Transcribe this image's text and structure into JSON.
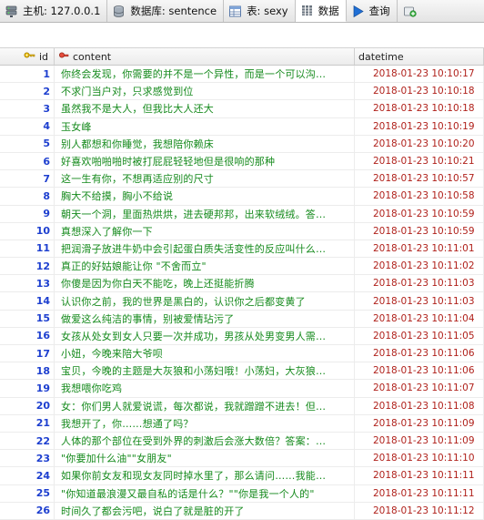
{
  "tabs": [
    {
      "icon": "server-icon",
      "label": "主机: 127.0.0.1"
    },
    {
      "icon": "database-icon",
      "label": "数据库: sentence"
    },
    {
      "icon": "table-icon",
      "label": "表: sexy"
    },
    {
      "icon": "data-grid-icon",
      "label": "数据"
    },
    {
      "icon": "play-icon",
      "label": "查询"
    },
    {
      "icon": "new-query-tab-icon",
      "label": ""
    }
  ],
  "active_tab": "数据",
  "columns": [
    {
      "icon": "key-icon",
      "label": "id"
    },
    {
      "icon": "field-icon",
      "label": "content"
    },
    {
      "icon": "",
      "label": "datetime"
    }
  ],
  "rows": [
    {
      "id": "1",
      "content": "你终会发现，你需要的并不是一个异性，而是一个可以沟…",
      "datetime": "2018-01-23 10:10:17"
    },
    {
      "id": "2",
      "content": "不求门当户对，只求感觉到位",
      "datetime": "2018-01-23 10:10:18"
    },
    {
      "id": "3",
      "content": "虽然我不是大人，但我比大人还大",
      "datetime": "2018-01-23 10:10:18"
    },
    {
      "id": "4",
      "content": "玉女峰",
      "datetime": "2018-01-23 10:10:19"
    },
    {
      "id": "5",
      "content": "别人都想和你睡觉，我想陪你赖床",
      "datetime": "2018-01-23 10:10:20"
    },
    {
      "id": "6",
      "content": "好喜欢啪啪啪时被打屁屁轻轻地但是很响的那种",
      "datetime": "2018-01-23 10:10:21"
    },
    {
      "id": "7",
      "content": "这一生有你，不想再适应别的尺寸",
      "datetime": "2018-01-23 10:10:57"
    },
    {
      "id": "8",
      "content": "胸大不给摸，胸小不给说",
      "datetime": "2018-01-23 10:10:58"
    },
    {
      "id": "9",
      "content": "朝天一个洞，里面热烘烘，进去硬邦邦，出来软绒绒。答…",
      "datetime": "2018-01-23 10:10:59"
    },
    {
      "id": "10",
      "content": "真想深入了解你一下",
      "datetime": "2018-01-23 10:10:59"
    },
    {
      "id": "11",
      "content": "把润滑子放进牛奶中会引起蛋白质失活变性的反应叫什么…",
      "datetime": "2018-01-23 10:11:01"
    },
    {
      "id": "12",
      "content": "真正的好姑娘能让你 \"不舍而立\"",
      "datetime": "2018-01-23 10:11:02"
    },
    {
      "id": "13",
      "content": "你傻是因为你白天不能吃，晚上还挺能折腾",
      "datetime": "2018-01-23 10:11:03"
    },
    {
      "id": "14",
      "content": "认识你之前，我的世界是黑白的，认识你之后都变黄了",
      "datetime": "2018-01-23 10:11:03"
    },
    {
      "id": "15",
      "content": "做爱这么纯洁的事情，别被爱情玷污了",
      "datetime": "2018-01-23 10:11:04"
    },
    {
      "id": "16",
      "content": "女孩从处女到女人只要一次并成功，男孩从处男变男人需…",
      "datetime": "2018-01-23 10:11:05"
    },
    {
      "id": "17",
      "content": "小妞，今晚来陪大爷呗",
      "datetime": "2018-01-23 10:11:06"
    },
    {
      "id": "18",
      "content": "宝贝，今晚的主题是大灰狼和小荡妇哦！小荡妇，大灰狼…",
      "datetime": "2018-01-23 10:11:06"
    },
    {
      "id": "19",
      "content": "我想喂你吃鸡",
      "datetime": "2018-01-23 10:11:07"
    },
    {
      "id": "20",
      "content": "女：你们男人就爱说谎，每次都说，我就蹭蹭不进去！但…",
      "datetime": "2018-01-23 10:11:08"
    },
    {
      "id": "21",
      "content": "我想开了，你……想通了吗？",
      "datetime": "2018-01-23 10:11:09"
    },
    {
      "id": "22",
      "content": "人体的那个部位在受到外界的刺激后会涨大数倍？答案：…",
      "datetime": "2018-01-23 10:11:09"
    },
    {
      "id": "23",
      "content": "\"你要加什么油\"\"女朋友\"",
      "datetime": "2018-01-23 10:11:10"
    },
    {
      "id": "24",
      "content": "如果你前女友和现女友同时掉水里了，那么请问……我能…",
      "datetime": "2018-01-23 10:11:11"
    },
    {
      "id": "25",
      "content": "\"你知道最浪漫又最自私的话是什么？\"\"你是我一个人的\"",
      "datetime": "2018-01-23 10:11:11"
    },
    {
      "id": "26",
      "content": "时间久了都会污吧，说白了就是脏的开了",
      "datetime": "2018-01-23 10:11:12"
    }
  ],
  "colors": {
    "id_text": "#1d3fcf",
    "content_text": "#158a1c",
    "datetime_text": "#b0211b"
  }
}
